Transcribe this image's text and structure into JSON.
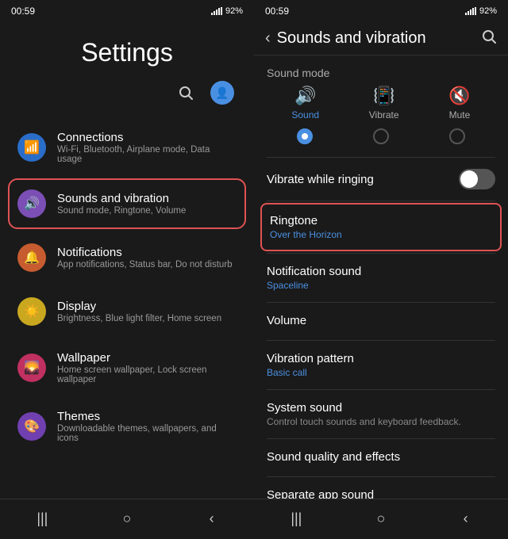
{
  "left": {
    "status": {
      "time": "00:59",
      "battery": "92%"
    },
    "title": "Settings",
    "search_label": "🔍",
    "profile_label": "👤",
    "items": [
      {
        "id": "connections",
        "icon": "📶",
        "icon_class": "icon-connections",
        "title": "Connections",
        "subtitle": "Wi-Fi, Bluetooth, Airplane mode, Data usage",
        "highlighted": false
      },
      {
        "id": "sounds",
        "icon": "🔊",
        "icon_class": "icon-sounds",
        "title": "Sounds and vibration",
        "subtitle": "Sound mode, Ringtone, Volume",
        "highlighted": true
      },
      {
        "id": "notifications",
        "icon": "🔔",
        "icon_class": "icon-notifications",
        "title": "Notifications",
        "subtitle": "App notifications, Status bar, Do not disturb",
        "highlighted": false
      },
      {
        "id": "display",
        "icon": "☀️",
        "icon_class": "icon-display",
        "title": "Display",
        "subtitle": "Brightness, Blue light filter, Home screen",
        "highlighted": false
      },
      {
        "id": "wallpaper",
        "icon": "🖼️",
        "icon_class": "icon-wallpaper",
        "title": "Wallpaper",
        "subtitle": "Home screen wallpaper, Lock screen wallpaper",
        "highlighted": false
      },
      {
        "id": "themes",
        "icon": "🎨",
        "icon_class": "icon-themes",
        "title": "Themes",
        "subtitle": "Downloadable themes, wallpapers, and icons",
        "highlighted": false
      }
    ],
    "nav": {
      "back": "|||",
      "home": "○",
      "recent": "‹"
    }
  },
  "right": {
    "status": {
      "time": "00:59",
      "battery": "92%"
    },
    "header": {
      "back": "‹",
      "title": "Sounds and vibration",
      "search": "🔍"
    },
    "sound_mode": {
      "label": "Sound mode",
      "options": [
        {
          "icon": "🔊",
          "label": "Sound",
          "active": true
        },
        {
          "icon": "📳",
          "label": "Vibrate",
          "active": false
        },
        {
          "icon": "🔇",
          "label": "Mute",
          "active": false
        }
      ]
    },
    "vibrate_while_ringing": {
      "label": "Vibrate while ringing",
      "on": false
    },
    "rows": [
      {
        "id": "ringtone",
        "title": "Ringtone",
        "value": "Over the Horizon",
        "subtitle": null,
        "highlighted": true
      },
      {
        "id": "notification-sound",
        "title": "Notification sound",
        "value": "Spaceline",
        "subtitle": null,
        "highlighted": false
      },
      {
        "id": "volume",
        "title": "Volume",
        "value": null,
        "subtitle": null,
        "highlighted": false
      },
      {
        "id": "vibration-pattern",
        "title": "Vibration pattern",
        "value": "Basic call",
        "subtitle": null,
        "highlighted": false
      },
      {
        "id": "system-sound",
        "title": "System sound",
        "value": null,
        "subtitle": "Control touch sounds and keyboard feedback.",
        "highlighted": false
      },
      {
        "id": "sound-quality",
        "title": "Sound quality and effects",
        "value": null,
        "subtitle": null,
        "highlighted": false
      },
      {
        "id": "separate-app-sound",
        "title": "Separate app sound",
        "value": null,
        "subtitle": null,
        "highlighted": false
      }
    ],
    "nav": {
      "back": "|||",
      "home": "○",
      "recent": "‹"
    }
  }
}
